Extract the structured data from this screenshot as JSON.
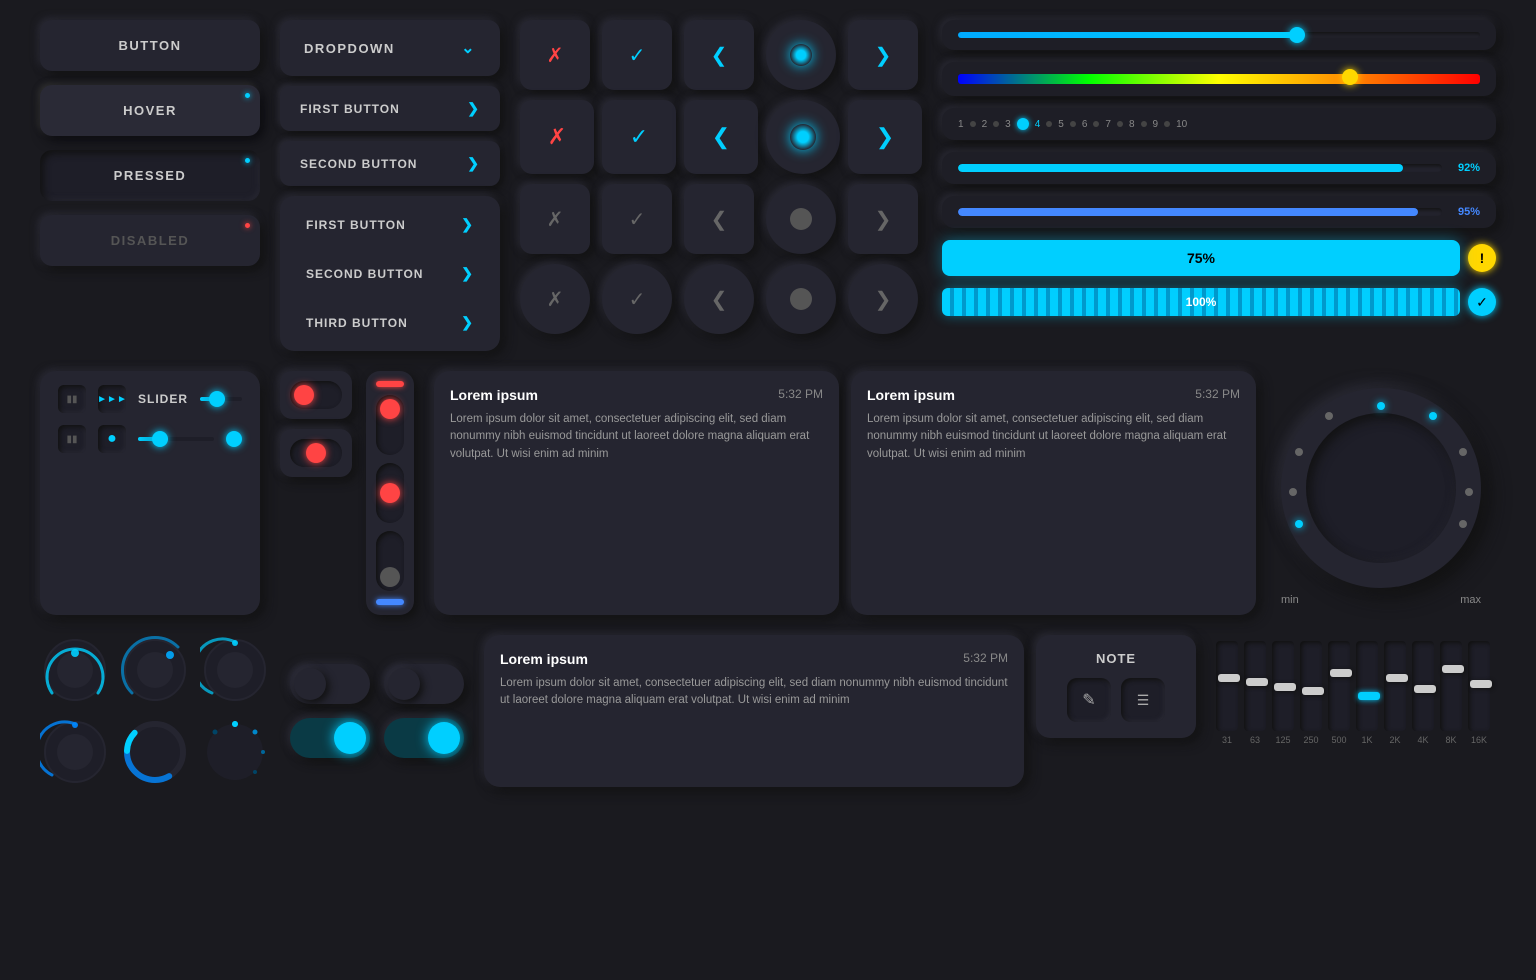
{
  "buttons": {
    "button_label": "BUTTON",
    "hover_label": "HOVER",
    "pressed_label": "PRESSED",
    "disabled_label": "DISABLED",
    "dropdown_label": "DROPDOWN",
    "first_button": "FIRST BUTTON",
    "second_button": "SECOND BUTTON",
    "third_button": "THIRD BUTTON"
  },
  "cards": [
    {
      "title": "Lorem ipsum",
      "time": "5:32 PM",
      "text": "Lorem ipsum dolor sit amet, consectetuer adipiscing elit, sed diam nonummy nibh euismod tincidunt ut laoreet dolore magna aliquam erat volutpat. Ut wisi enim ad minim"
    },
    {
      "title": "Lorem ipsum",
      "time": "5:32 PM",
      "text": "Lorem ipsum dolor sit amet, consectetuer adipiscing elit, sed diam nonummy nibh euismod tincidunt ut laoreet dolore magna aliquam erat volutpat. Ut wisi enim ad minim"
    },
    {
      "title": "Lorem ipsum",
      "time": "5:32 PM",
      "text": "Lorem ipsum dolor sit amet, consectetuer adipiscing elit, sed diam nonummy nibh euismod tincidunt ut laoreet dolore magna aliquam erat volutpat. Ut wisi enim ad minim"
    }
  ],
  "note": {
    "label": "NOTE"
  },
  "sliders": {
    "label": "SLIDER",
    "progress1_pct": "92%",
    "progress2_pct": "95%",
    "progress3_pct": "75%",
    "progress4_pct": "100%"
  },
  "eq_labels": [
    "31",
    "63",
    "125",
    "250",
    "500",
    "1K",
    "2K",
    "4K",
    "8K",
    "16K"
  ],
  "eq_heights": [
    60,
    55,
    50,
    45,
    70,
    35,
    65,
    40,
    75,
    50
  ],
  "knob": {
    "min_label": "min",
    "max_label": "max"
  }
}
